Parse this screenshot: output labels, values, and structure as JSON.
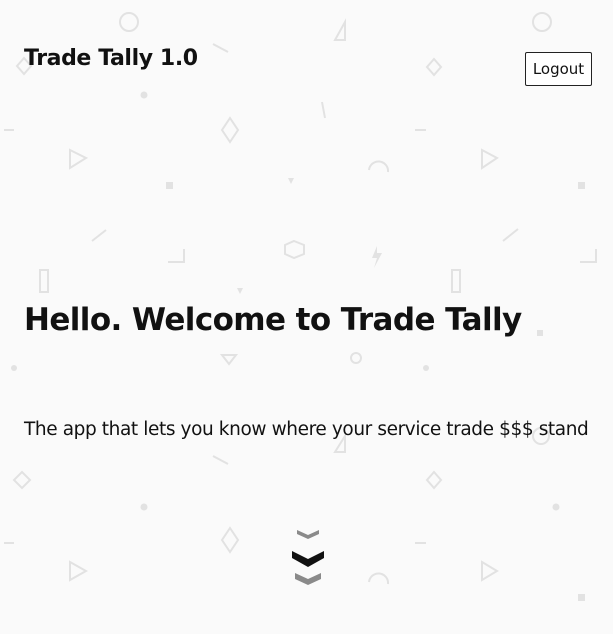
{
  "header": {
    "app_title": "Trade Tally 1.0",
    "logout_label": "Logout"
  },
  "hero": {
    "title": "Hello. Welcome to Trade Tally",
    "subtitle": "The app that lets you know where your service trade $$$ stand"
  },
  "icons": {
    "scroll_down": "chevrons-down-icon"
  },
  "colors": {
    "background": "#fafafa",
    "pattern": "#e3e3e3",
    "text": "#111111",
    "chevron": "#777777"
  }
}
